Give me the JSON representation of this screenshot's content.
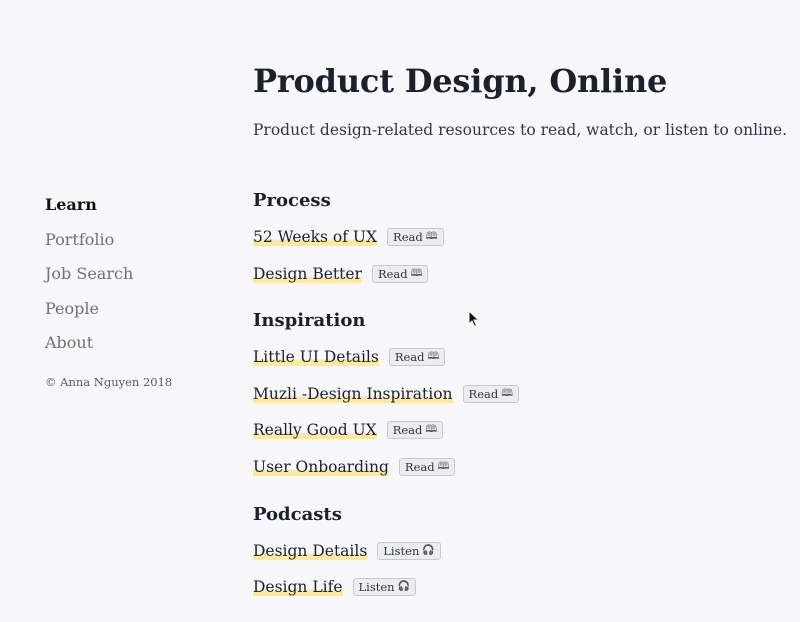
{
  "header": {
    "title": "Product Design, Online",
    "subtitle": "Product design-related resources to read, watch, or listen to online."
  },
  "sidebar": {
    "items": [
      {
        "label": "Learn",
        "active": true
      },
      {
        "label": "Portfolio"
      },
      {
        "label": "Job Search"
      },
      {
        "label": "People"
      },
      {
        "label": "About"
      }
    ],
    "copyright": "© Anna Nguyen 2018"
  },
  "sections": [
    {
      "title": "Process",
      "items": [
        {
          "label": "52 Weeks of UX",
          "badge": "Read",
          "icon": "📖"
        },
        {
          "label": "Design Better",
          "badge": "Read",
          "icon": "📖"
        }
      ]
    },
    {
      "title": "Inspiration",
      "items": [
        {
          "label": "Little UI Details",
          "badge": "Read",
          "icon": "📖"
        },
        {
          "label": "Muzli -Design Inspiration",
          "badge": "Read",
          "icon": "📖"
        },
        {
          "label": "Really Good UX",
          "badge": "Read",
          "icon": "📖"
        },
        {
          "label": "User Onboarding",
          "badge": "Read",
          "icon": "📖"
        }
      ]
    },
    {
      "title": "Podcasts",
      "items": [
        {
          "label": "Design Details",
          "badge": "Listen",
          "icon": "🎧"
        },
        {
          "label": "Design Life",
          "badge": "Listen",
          "icon": "🎧"
        }
      ]
    }
  ],
  "colors": {
    "highlight": "#fde8a6",
    "background": "#f8f8fb"
  }
}
